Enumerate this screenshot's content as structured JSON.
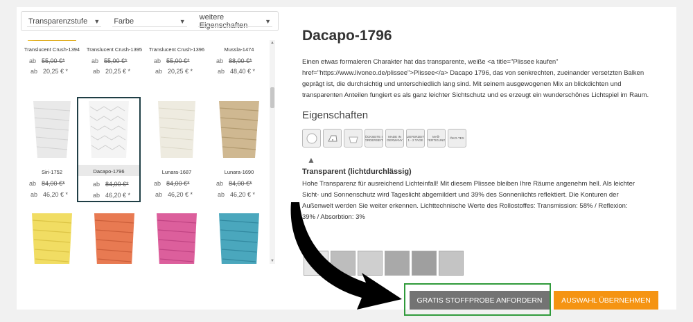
{
  "filters": [
    {
      "label": "Transparenzstufe"
    },
    {
      "label": "Farbe"
    },
    {
      "label": "weitere Eigenschaften"
    }
  ],
  "products": [
    {
      "name": "Translucent Crush-1394",
      "ab": "ab",
      "old_price": "55,00 €*",
      "new_price": "20,25 € *",
      "color": "#f2c53b"
    },
    {
      "name": "Translucent Crush-1395",
      "ab": "ab",
      "old_price": "55,00 €*",
      "new_price": "20,25 € *",
      "color": "#f2c53b"
    },
    {
      "name": "Translucent Crush-1396",
      "ab": "ab",
      "old_price": "55,00 €*",
      "new_price": "20,25 € *",
      "color": "#ef9a3d"
    },
    {
      "name": "Mussla-1474",
      "ab": "ab",
      "old_price": "88,00 €*",
      "new_price": "48,40 € *",
      "color": "#e86b3a"
    },
    {
      "name": "Siri-1752",
      "ab": "ab",
      "old_price": "84,00 €*",
      "new_price": "46,20 € *",
      "color": "#e9e9e9"
    },
    {
      "name": "Dacapo-1796",
      "ab": "ab",
      "old_price": "84,00 €*",
      "new_price": "46,20 € *",
      "color": "#f2f2f2"
    },
    {
      "name": "Lunara-1687",
      "ab": "ab",
      "old_price": "84,00 €*",
      "new_price": "46,20 € *",
      "color": "#ece9dd"
    },
    {
      "name": "Lunara-1690",
      "ab": "ab",
      "old_price": "84,00 €*",
      "new_price": "46,20 € *",
      "color": "#cdb68e"
    },
    {
      "color": "#f1dd63"
    },
    {
      "color": "#e87a52"
    },
    {
      "color": "#dc5f9c"
    },
    {
      "color": "#4aa7bd"
    }
  ],
  "detail": {
    "title": "Dacapo-1796",
    "description": "Einen etwas formaleren Charakter hat das transparente, weiße <a title=\"Plissee kaufen\" href=\"https://www.livoneo.de/plissee\">Plissee</a> Dacapo 1796, das von senkrechten, zueinander versetzten Balken geprägt ist, die durchsichtig und unterschiedlich lang sind. Mit seinem ausgewogenen Mix an blickdichten und transparenten Anteilen fungiert es als ganz leichter Sichtschutz und es erzeugt ein wunderschönes Lichtspiel im Raum.",
    "properties_title": "Eigenschaften",
    "icons": [
      {
        "label": "",
        "icon": "transparency-icon"
      },
      {
        "label": "",
        "icon": "iron-icon"
      },
      {
        "label": "",
        "icon": "wash-icon"
      },
      {
        "label": "RÜCKSEITE IM VORDERSEITE",
        "icon": "backside-icon"
      },
      {
        "label": "MADE IN GERMANY",
        "icon": "made-in-germany-icon"
      },
      {
        "label": "LIEFERZEIT 1 - 2 TAGE",
        "icon": "delivery-time-icon"
      },
      {
        "label": "MAß-FERTIGUNG",
        "icon": "custom-made-icon"
      },
      {
        "label": "ÖKO-TEX",
        "icon": "oeko-tex-icon"
      }
    ],
    "indicator": "▲",
    "feature_title": "Transparent (lichtdurchlässig)",
    "feature_text": "Hohe Transparenz für ausreichend Lichteinfall! Mit diesem Plissee bleiben Ihre Räume angenehm hell. Als leichter Sicht- und Sonnenschutz wird Tageslicht abgemildert und 39% des Sonnenlichts reflektiert. Die Konturen der Außenwelt werden Sie weiter erkennen. Lichttechnische Werte des Rollostoffes: Transmission: 58% / Reflexion: 39% / Absorbtion: 3%"
  },
  "buttons": {
    "sample": "GRATIS STOFFPROBE ANFORDERN",
    "select": "AUSWAHL ÜBERNEHMEN"
  },
  "colors": {
    "accent_orange": "#f59412",
    "sample_gray": "#737373",
    "highlight_green": "#2f9a3a",
    "selected_border": "#1f3e45"
  }
}
